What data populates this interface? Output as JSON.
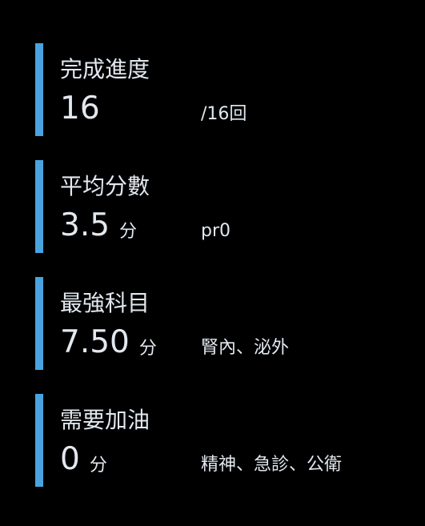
{
  "accent_color": "#4aa3df",
  "stats": [
    {
      "title": "完成進度",
      "value": "16",
      "unit": "",
      "detail": "/16回"
    },
    {
      "title": "平均分數",
      "value": "3.5",
      "unit": "分",
      "detail": "pr0"
    },
    {
      "title": "最強科目",
      "value": "7.50",
      "unit": "分",
      "detail": "腎內、泌外"
    },
    {
      "title": "需要加油",
      "value": "0",
      "unit": "分",
      "detail": "精神、急診、公衛"
    }
  ]
}
